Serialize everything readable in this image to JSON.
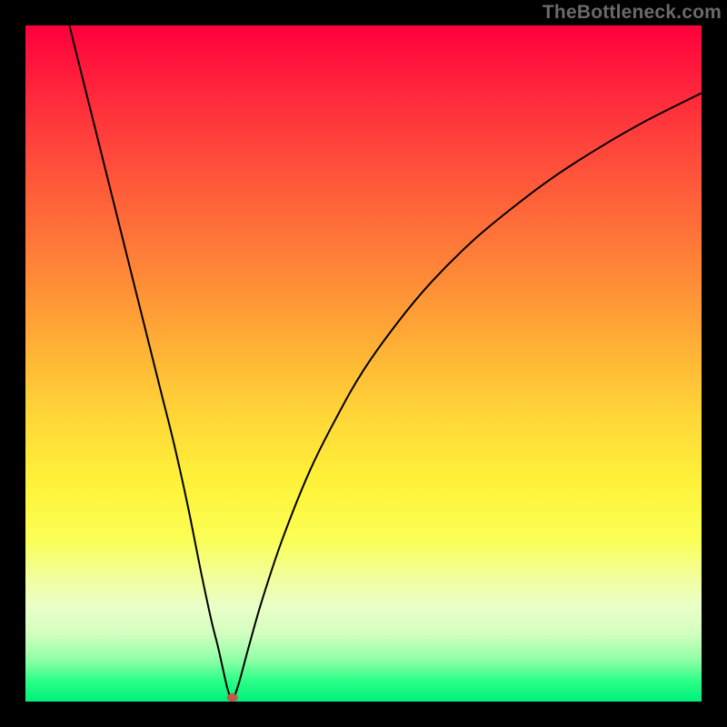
{
  "watermark": "TheBottleneck.com",
  "chart_data": {
    "type": "line",
    "title": "",
    "xlabel": "",
    "ylabel": "",
    "xlim": [
      0,
      100
    ],
    "ylim": [
      0,
      100
    ],
    "grid": false,
    "background_gradient": [
      "#ff003c",
      "#ffd738",
      "#00f07a"
    ],
    "marker": {
      "x": 30.6,
      "y": 0.6,
      "color": "#c5564a"
    },
    "series": [
      {
        "name": "curve",
        "stroke": "#000000",
        "x": [
          6.5,
          8,
          10,
          12,
          14,
          16,
          18,
          20,
          22,
          24,
          26,
          27.5,
          28.5,
          29.5,
          30,
          30.6,
          31.5,
          33,
          35,
          38,
          42,
          46,
          50,
          55,
          60,
          66,
          72,
          78,
          85,
          92,
          100
        ],
        "y": [
          100,
          94,
          86,
          78,
          70,
          62,
          54,
          46,
          38,
          29,
          19,
          12,
          8,
          3.5,
          1.5,
          0.4,
          2.5,
          8,
          15,
          24,
          34,
          42,
          49,
          56,
          62,
          68,
          73,
          77.5,
          82,
          86,
          90
        ]
      }
    ]
  }
}
